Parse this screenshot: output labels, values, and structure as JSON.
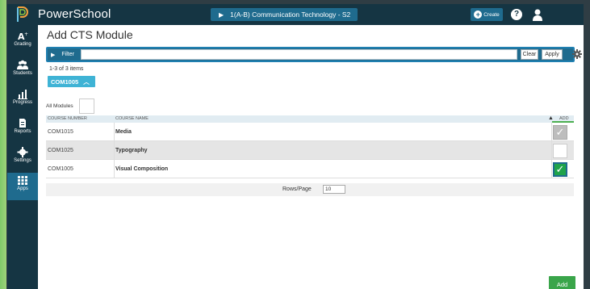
{
  "app": {
    "brand": "PowerSchool",
    "course_selector": "1(A-B) Communication Technology - S2",
    "create_label": "Create",
    "help_glyph": "?"
  },
  "sidebar": {
    "items": [
      {
        "label": "Grading",
        "icon": "grading-icon"
      },
      {
        "label": "Students",
        "icon": "students-icon"
      },
      {
        "label": "Progress",
        "icon": "progress-icon"
      },
      {
        "label": "Reports",
        "icon": "reports-icon"
      },
      {
        "label": "Settings",
        "icon": "settings-icon"
      },
      {
        "label": "Apps",
        "icon": "apps-icon",
        "active": true
      }
    ]
  },
  "page": {
    "title": "Add CTS Module",
    "filter_label": "Filter",
    "filter_value": "",
    "clear_label": "Clear",
    "apply_label": "Apply",
    "items_count": "1-3 of 3 items",
    "chip_label": "COM1005",
    "all_modules_label": "All Modules",
    "rows_per_page_label": "Rows/Page",
    "rows_per_page_value": "10",
    "add_button_label": "Add"
  },
  "table": {
    "headers": [
      "COURSE NUMBER",
      "COURSE NAME",
      "ADD"
    ],
    "rows": [
      {
        "number": "COM1015",
        "name": "Media",
        "add_state": "checked-disabled"
      },
      {
        "number": "COM1025",
        "name": "Typography",
        "add_state": "unchecked"
      },
      {
        "number": "COM1005",
        "name": "Visual Composition",
        "add_state": "checked"
      }
    ]
  },
  "colors": {
    "nav_bg": "#153543",
    "accent": "#1f6b8e",
    "chip": "#3fb3d5",
    "success": "#3aa54a"
  }
}
